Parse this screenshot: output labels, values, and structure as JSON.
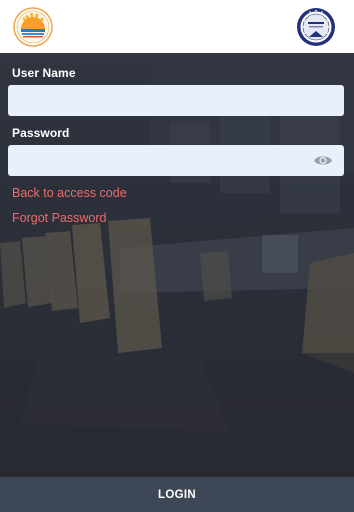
{
  "form": {
    "username_label": "User Name",
    "username_value": "",
    "password_label": "Password",
    "password_value": ""
  },
  "links": {
    "back_to_access_code": "Back to access code",
    "forgot_password": "Forgot Password"
  },
  "footer": {
    "login_label": "LOGIN"
  },
  "icons": {
    "left_logo": "sunrise-emblem-logo",
    "right_logo": "circular-seal-logo",
    "password_toggle": "eye-icon"
  },
  "colors": {
    "field_background": "#e8effd",
    "link_color": "#ef6b6b",
    "login_bar": "#3e4756",
    "panel_background": "#2c303a"
  }
}
